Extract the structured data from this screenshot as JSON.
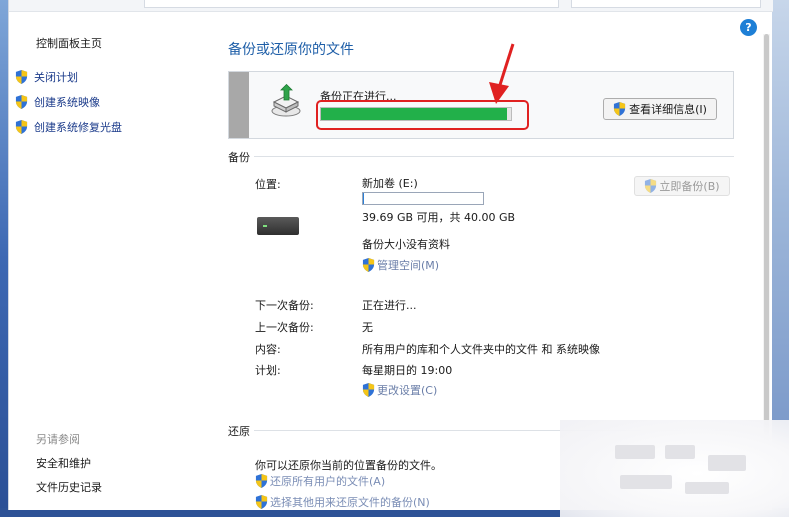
{
  "sidebar": {
    "home": "控制面板主页",
    "items": [
      {
        "label": "关闭计划"
      },
      {
        "label": "创建系统映像"
      },
      {
        "label": "创建系统修复光盘"
      }
    ],
    "see_also_title": "另请参阅",
    "see_also": [
      {
        "label": "安全和维护"
      },
      {
        "label": "文件历史记录"
      }
    ]
  },
  "main": {
    "title": "备份或还原你的文件",
    "help_icon": "?",
    "progress": {
      "label": "备份正在进行...",
      "fraction": 0.98,
      "details_button": "查看详细信息(I)"
    },
    "backup": {
      "section_title": "备份",
      "location_label": "位置:",
      "location_value": "新加卷 (E:)",
      "drive_used_fraction": 0.01,
      "space_text": "39.69 GB 可用，共 40.00 GB",
      "size_text": "备份大小没有资料",
      "manage_space": "管理空间(M)",
      "backup_now": "立即备份(B)",
      "next_label": "下一次备份:",
      "next_value": "正在进行...",
      "last_label": "上一次备份:",
      "last_value": "无",
      "contents_label": "内容:",
      "contents_value": "所有用户的库和个人文件夹中的文件 和 系统映像",
      "schedule_label": "计划:",
      "schedule_value": "每星期日的 19:00",
      "change_settings": "更改设置(C)"
    },
    "restore": {
      "section_title": "还原",
      "text": "你可以还原你当前的位置备份的文件。",
      "link1": "还原所有用户的文件(A)",
      "link2": "选择其他用来还原文件的备份(N)"
    }
  },
  "colors": {
    "accent_blue": "#1f5fa8",
    "progress_green": "#22b04a",
    "annotation_red": "#e02121"
  }
}
